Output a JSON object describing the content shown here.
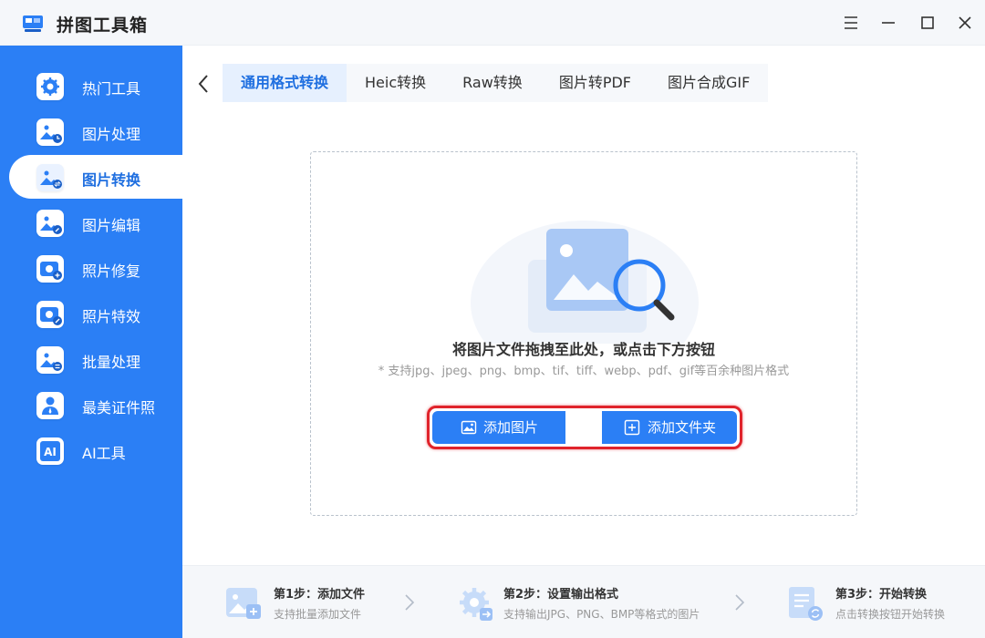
{
  "app": {
    "title": "拼图工具箱",
    "accent_color": "#2b7ff5",
    "highlight_color": "#e0232b"
  },
  "window_controls": [
    {
      "name": "menu",
      "icon": "hamburger-menu-icon"
    },
    {
      "name": "minimize",
      "icon": "minimize-icon"
    },
    {
      "name": "maximize",
      "icon": "maximize-icon"
    },
    {
      "name": "close",
      "icon": "close-icon"
    }
  ],
  "sidebar": {
    "items": [
      {
        "label": "热门工具",
        "icon": "hot-tools-gear-icon"
      },
      {
        "label": "图片处理",
        "icon": "image-process-icon"
      },
      {
        "label": "图片转换",
        "icon": "image-convert-icon",
        "active": true
      },
      {
        "label": "图片编辑",
        "icon": "image-edit-icon"
      },
      {
        "label": "照片修复",
        "icon": "photo-repair-icon"
      },
      {
        "label": "照片特效",
        "icon": "photo-effects-icon"
      },
      {
        "label": "批量处理",
        "icon": "batch-process-icon"
      },
      {
        "label": "最美证件照",
        "icon": "id-photo-icon"
      },
      {
        "label": "AI工具",
        "icon": "ai-tools-icon"
      }
    ]
  },
  "tabs": [
    {
      "label": "通用格式转换",
      "active": true
    },
    {
      "label": "Heic转换"
    },
    {
      "label": "Raw转换"
    },
    {
      "label": "图片转PDF"
    },
    {
      "label": "图片合成GIF"
    }
  ],
  "dropzone": {
    "title": "将图片文件拖拽至此处，或点击下方按钮",
    "hint": "* 支持jpg、jpeg、png、bmp、tif、tiff、webp、pdf、gif等百余种图片格式",
    "add_image_label": "添加图片",
    "add_folder_label": "添加文件夹"
  },
  "steps": [
    {
      "title": "第1步：添加文件",
      "desc": "支持批量添加文件",
      "icon": "add-file-step-icon"
    },
    {
      "title": "第2步：设置输出格式",
      "desc": "支持输出JPG、PNG、BMP等格式的图片",
      "icon": "settings-step-icon"
    },
    {
      "title": "第3步：开始转换",
      "desc": "点击转换按钮开始转换",
      "icon": "convert-step-icon"
    }
  ]
}
